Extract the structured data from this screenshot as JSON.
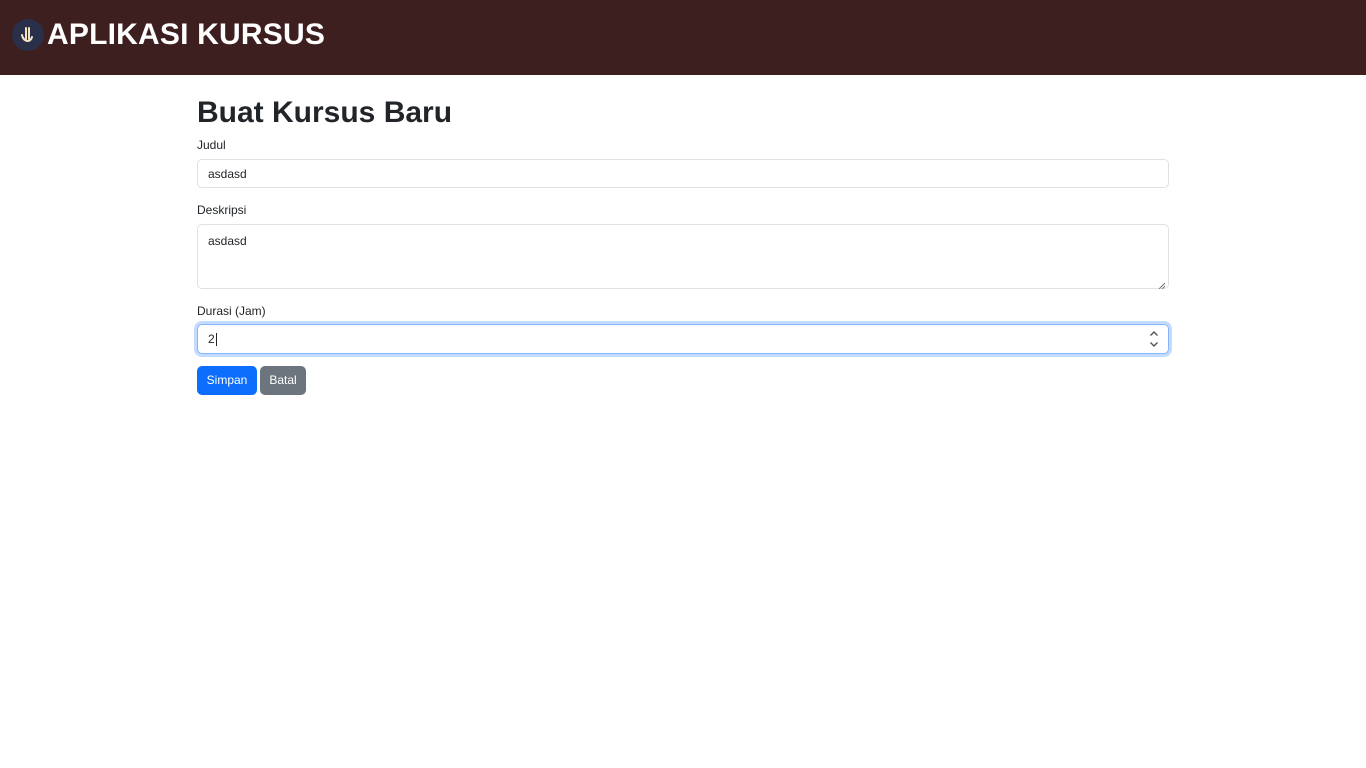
{
  "navbar": {
    "brand_title": "APLIKASI KURSUS",
    "logo_icon": "hand-logo-icon",
    "background": "#3d1f20"
  },
  "form": {
    "title": "Buat Kursus Baru",
    "judul": {
      "label": "Judul",
      "value": "asdasd"
    },
    "deskripsi": {
      "label": "Deskripsi",
      "value": "asdasd"
    },
    "durasi": {
      "label": "Durasi (Jam)",
      "value": "2"
    },
    "buttons": {
      "save_label": "Simpan",
      "cancel_label": "Batal"
    }
  },
  "colors": {
    "primary": "#0d6efd",
    "secondary": "#6c757d",
    "focus_border": "#86b7fe"
  }
}
